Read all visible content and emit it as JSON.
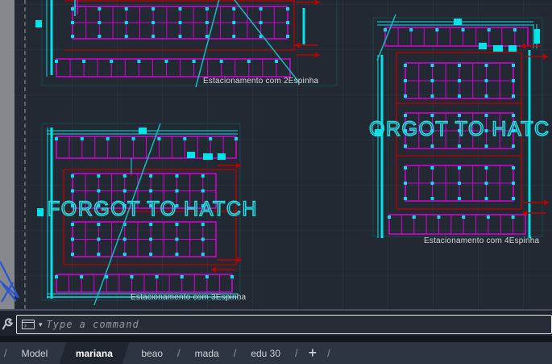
{
  "canvas": {
    "drawings": [
      {
        "label": "Estacionamento com 2Espinha"
      },
      {
        "label": "Estacionamento com 3Espinha",
        "overlay_text": "FORGOT TO HATCH"
      },
      {
        "label": "Estacionamento com 4Espinha",
        "overlay_text": "ORGOT TO HATC"
      }
    ]
  },
  "command_bar": {
    "placeholder": "Type a command",
    "caret_glyph": "▾",
    "icons": [
      "wrench-icon",
      "command-prompt-icon",
      "chevron-down-icon"
    ]
  },
  "tab_bar": {
    "separator": "/",
    "tabs": [
      {
        "label": "Model",
        "active": false
      },
      {
        "label": "mariana",
        "active": true
      },
      {
        "label": "beao",
        "active": false
      },
      {
        "label": "mada",
        "active": false
      },
      {
        "label": "edu 30",
        "active": false
      }
    ],
    "add_label": "+"
  },
  "colors": {
    "canvas_background": "#222932",
    "stall_magenta": "#d800d8",
    "entity_cyan": "#00e4ea",
    "lane_red": "#c00000",
    "label_text": "#d6dade",
    "overlay_text_cyan": "#25dde3",
    "tab_bar_background": "#2d3542",
    "active_tab_background": "#1f2630"
  }
}
